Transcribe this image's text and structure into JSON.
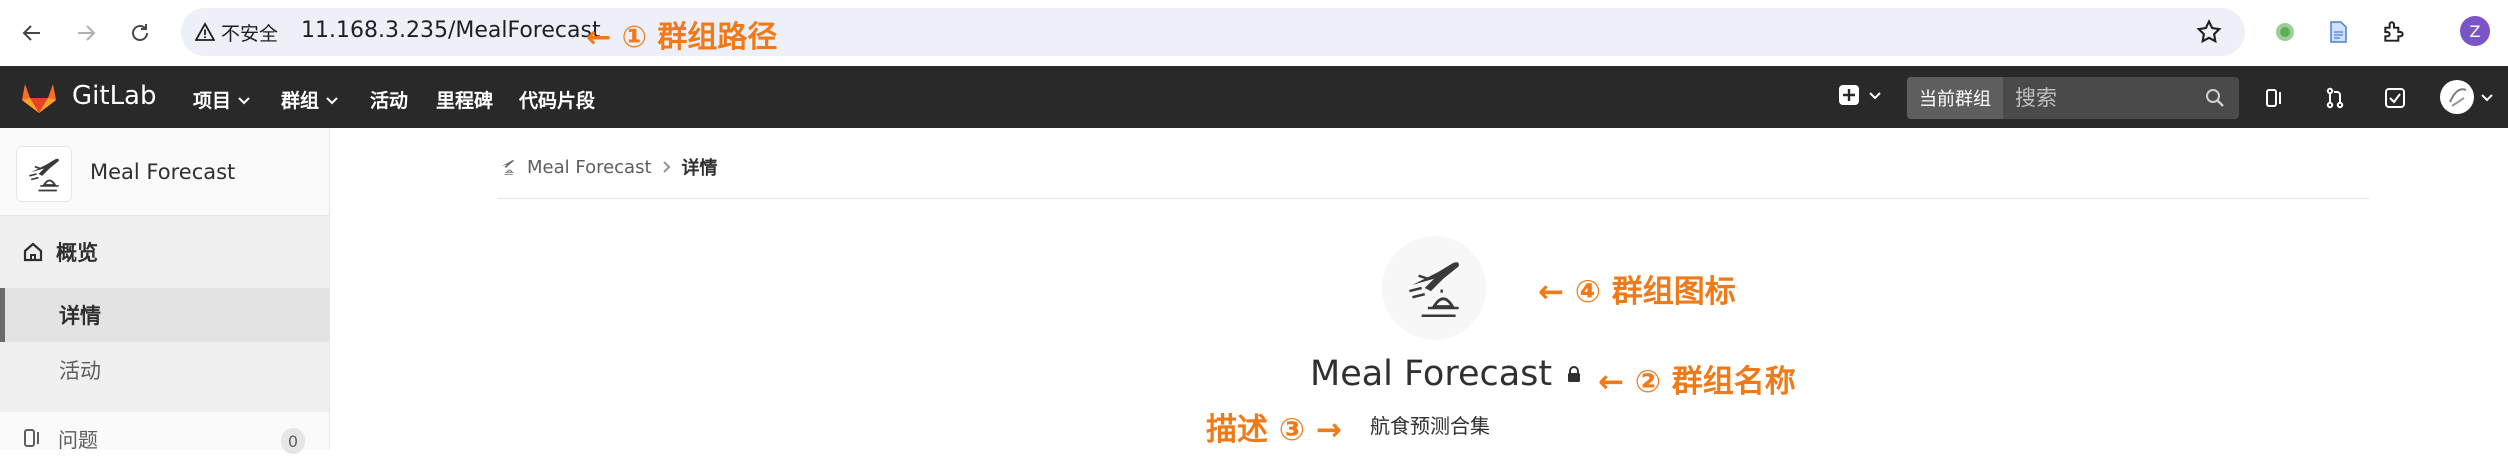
{
  "browser": {
    "security_label": "不安全",
    "url": "11.168.3.235/MealForecast",
    "profile_initial": "Z"
  },
  "gitlab_nav": {
    "brand": "GitLab",
    "items": [
      {
        "label": "项目",
        "has_dropdown": true
      },
      {
        "label": "群组",
        "has_dropdown": true
      },
      {
        "label": "活动",
        "has_dropdown": false
      },
      {
        "label": "里程碑",
        "has_dropdown": false
      },
      {
        "label": "代码片段",
        "has_dropdown": false
      }
    ],
    "search_scope": "当前群组",
    "search_placeholder": "搜索"
  },
  "sidebar": {
    "group_title": "Meal Forecast",
    "overview_label": "概览",
    "sub_items": [
      {
        "label": "详情",
        "active": true
      },
      {
        "label": "活动",
        "active": false
      }
    ],
    "issues_label": "问题",
    "issues_count": "0"
  },
  "breadcrumb": {
    "parent": "Meal Forecast",
    "current": "详情"
  },
  "group": {
    "name": "Meal Forecast",
    "description": "航食预测合集"
  },
  "annotations": {
    "path": "← ① 群组路径",
    "icon": "← ④ 群组图标",
    "name": "← ② 群组名称",
    "description": "描述 ③ →"
  },
  "colors": {
    "annotation": "#f07a18",
    "navbar_bg": "#292929",
    "profile_avatar": "#7b55c7"
  }
}
